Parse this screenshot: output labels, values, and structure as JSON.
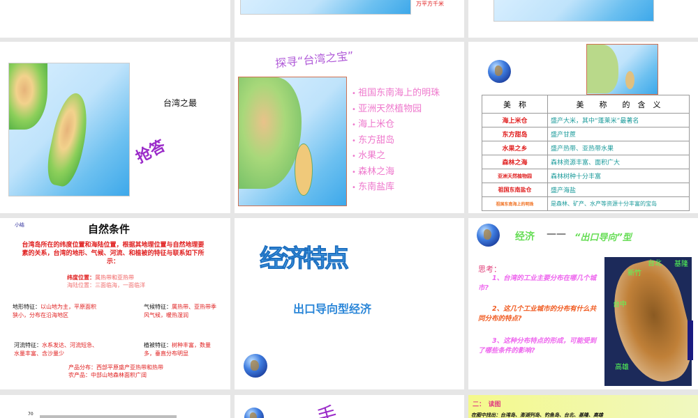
{
  "top_row": {
    "slide2_caption": "万平方千米"
  },
  "slide_taiwan_most": {
    "title": "台湾之最",
    "qiangda": "抢答"
  },
  "slide_treasure": {
    "title": "探寻“台湾之宝”",
    "bullets": [
      "祖国东南海上的明珠",
      "亚洲天然植物园",
      "海上米仓",
      "东方甜岛",
      "水果之",
      "森林之海",
      "东南盐库"
    ]
  },
  "slide_table": {
    "header": [
      "美　称",
      "美　　称　　的　含　义"
    ],
    "rows": [
      {
        "name": "海上米仓",
        "meaning": "盛产大米，其中“蓬莱米”最著名"
      },
      {
        "name": "东方甜岛",
        "meaning": "盛产甘蔗"
      },
      {
        "name": "水果之乡",
        "meaning": "盛产热带、亚热带水果"
      },
      {
        "name": "森林之海",
        "meaning": "森林资源丰富、面积广大"
      },
      {
        "name": "亚洲天然植物园",
        "meaning": "森林树种十分丰富"
      },
      {
        "name": "祖国东南盐仓",
        "meaning": "盛产海盐"
      },
      {
        "name": "祖国东南海上的明珠",
        "meaning": "是森林、矿产、水产等资源十分丰富的宝岛"
      }
    ]
  },
  "slide_natural": {
    "tag": "小结",
    "title": "自然条件",
    "intro": "台湾岛所在的纬度位置和海陆位置，根据其地理位置与自然地理要素的关系，台湾的地形、气候、河流、和植被的特征与联系如下所示：",
    "lat_label": "纬度位置：",
    "lat_value": "属热带和亚热带",
    "sea_label": "海陆位置：",
    "sea_value": "三面临海，一面临洋",
    "terrain_label": "地形特征：",
    "terrain_value": "以山地为主，平原面积狭小，分布在沿海地区",
    "climate_label": "气候特征：",
    "climate_value": "属热带、亚热带季风气候，暖热湿润",
    "river_label": "河流特征：",
    "river_value": "水系发达、河流短急、水量丰富、含沙量少",
    "veg_label": "植被特征：",
    "veg_value": "树种丰富，数量多，垂直分布明显",
    "product1": "产品分布：西部平原盛产亚热带和热带",
    "product2": "农产品：中部山地森林面积广阔"
  },
  "slide_economy": {
    "title": "经济特点",
    "subtitle": "出口导向型经济"
  },
  "slide_export": {
    "title": "经济",
    "dash": "——",
    "type": "“出口导向”型",
    "think": "思考：",
    "q1": "1、台湾的工业主要分布在哪几个城市?",
    "q2": "2、这几个工业城市的分布有什么共同分布的特点?",
    "q3": "3、这种分布特点的形成，可能受到了哪些条件的影响?",
    "cities": [
      "台北",
      "基隆",
      "新竹",
      "台中",
      "高雄"
    ]
  },
  "bottom_row": {
    "axis_value": "70",
    "hand_text": "手",
    "read_title": "二：　读图",
    "read_line": "在图中找出：台湾岛、澎湖列岛、钓鱼岛、台北、基隆、高雄"
  }
}
